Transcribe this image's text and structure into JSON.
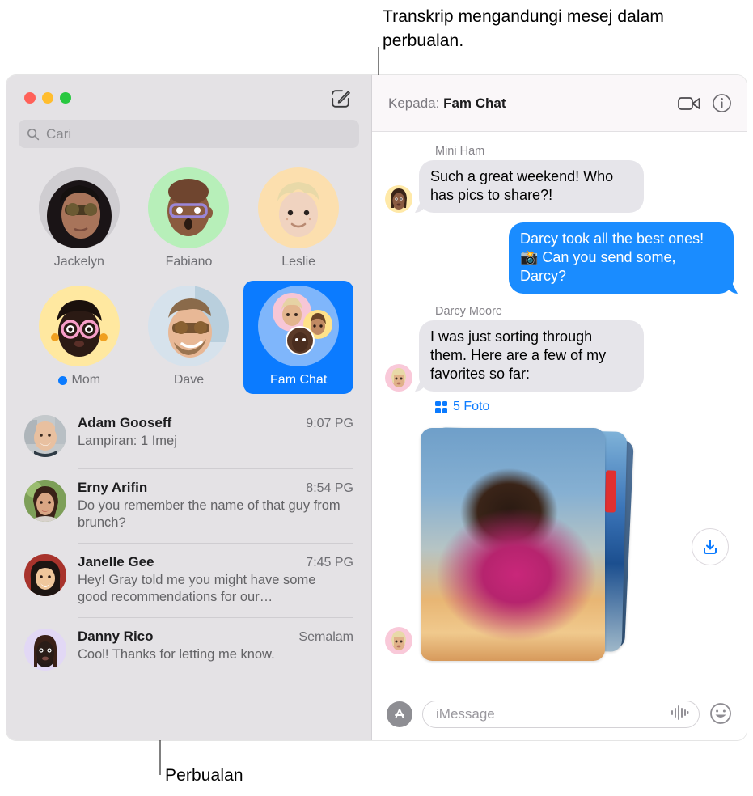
{
  "callouts": {
    "top": "Transkrip mengandungi mesej dalam perbualan.",
    "bottom": "Perbualan"
  },
  "colors": {
    "accent": "#0b7bff",
    "bubble_out": "#1a8cff",
    "bubble_in": "#e6e5ea",
    "sidebar_bg": "#e4e2e5",
    "traffic_red": "#ff6159",
    "traffic_yellow": "#ffbd2e",
    "traffic_green": "#28c840"
  },
  "window": {
    "traffic_lights": [
      "close-button",
      "minimize-button",
      "zoom-button"
    ],
    "compose_icon": "compose-icon"
  },
  "sidebar": {
    "search": {
      "placeholder": "Cari",
      "icon": "search-icon",
      "value": ""
    },
    "pinned": [
      {
        "name": "Jackelyn",
        "selected": false,
        "unread": false,
        "avatar": "photo-woman-sunglasses"
      },
      {
        "name": "Fabiano",
        "selected": false,
        "unread": false,
        "avatar": "memoji-bald-purple-glasses"
      },
      {
        "name": "Leslie",
        "selected": false,
        "unread": false,
        "avatar": "memoji-blond-curly"
      },
      {
        "name": "Mom",
        "selected": false,
        "unread": true,
        "avatar": "memoji-pink-glasses"
      },
      {
        "name": "Dave",
        "selected": false,
        "unread": false,
        "avatar": "photo-man-sunglasses"
      },
      {
        "name": "Fam Chat",
        "selected": true,
        "unread": false,
        "avatar": "group-avatar"
      }
    ],
    "conversations": [
      {
        "name": "Adam Gooseff",
        "time": "9:07 PG",
        "preview": "Lampiran: 1 Imej",
        "avatar": "photo-bald-man"
      },
      {
        "name": "Erny Arifin",
        "time": "8:54 PG",
        "preview": "Do you remember the name of that guy from brunch?",
        "avatar": "photo-woman-dark-hair"
      },
      {
        "name": "Janelle Gee",
        "time": "7:45 PG",
        "preview": "Hey! Gray told me you might have some good recommendations for our…",
        "avatar": "photo-woman-bob"
      },
      {
        "name": "Danny Rico",
        "time": "Semalam",
        "preview": "Cool! Thanks for letting me know.",
        "avatar": "memoji-locs"
      }
    ]
  },
  "chat": {
    "header": {
      "to_label": "Kepada:",
      "title": "Fam Chat",
      "facetime_icon": "video-camera-icon",
      "info_icon": "info-icon"
    },
    "messages": [
      {
        "sender": "Mini Ham",
        "text": "Such a great weekend! Who has pics to share?!",
        "direction": "in",
        "avatar": "memoji-braids-yellow"
      },
      {
        "sender": "",
        "text": "Darcy took all the best ones! 📸 Can you send some, Darcy?",
        "direction": "out",
        "avatar": ""
      },
      {
        "sender": "Darcy Moore",
        "text": "I was just sorting through them. Here are a few of my favorites so far:",
        "direction": "in",
        "avatar": "memoji-blonde-pink"
      }
    ],
    "attachment": {
      "label": "5 Foto",
      "grid_icon": "photo-grid-icon",
      "download_icon": "download-icon",
      "avatar": "memoji-blonde-pink"
    },
    "composer": {
      "apps_icon": "app-store-icon",
      "placeholder": "iMessage",
      "value": "",
      "audio_icon": "audio-waveform-icon",
      "emoji_icon": "smiley-face-icon"
    }
  }
}
